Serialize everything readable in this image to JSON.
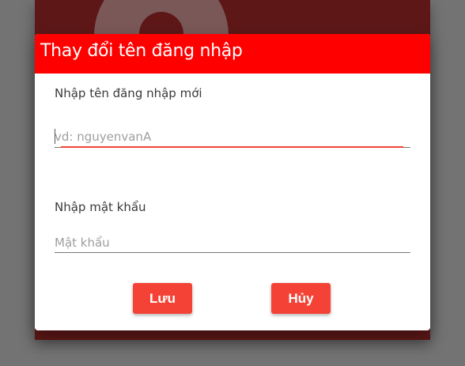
{
  "dialog": {
    "title": "Thay đổi tên đăng nhập",
    "header_color": "#ff0000",
    "username": {
      "label": "Nhập tên đăng nhập mới",
      "placeholder": "vd: nguyenvanA",
      "value": ""
    },
    "password": {
      "label": "Nhập mật khẩu",
      "placeholder": "Mật khẩu",
      "value": ""
    },
    "buttons": {
      "save_label": "Lưu",
      "cancel_label": "Hủy",
      "color": "#f44336"
    }
  },
  "background": {
    "avatar_icon": "user-avatar-icon"
  }
}
